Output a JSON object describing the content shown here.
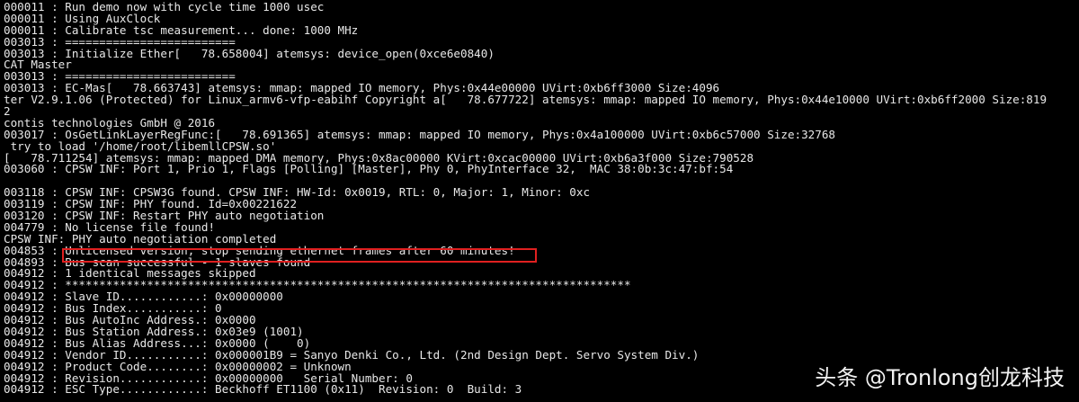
{
  "terminal": {
    "lines": [
      "000011 : Run demo now with cycle time 1000 usec",
      "000011 : Using AuxClock",
      "000011 : Calibrate tsc measurement... done: 1000 MHz",
      "003013 : =========================",
      "003013 : Initialize Ether[   78.658004] atemsys: device_open(0xce6e0840)",
      "CAT Master",
      "003013 : =========================",
      "003013 : EC-Mas[   78.663743] atemsys: mmap: mapped IO memory, Phys:0x44e00000 UVirt:0xb6ff3000 Size:4096",
      "ter V2.9.1.06 (Protected) for Linux_armv6-vfp-eabihf Copyright a[   78.677722] atemsys: mmap: mapped IO memory, Phys:0x44e10000 UVirt:0xb6ff2000 Size:819",
      "2",
      "contis technologies GmbH @ 2016",
      "003017 : OsGetLinkLayerRegFunc:[   78.691365] atemsys: mmap: mapped IO memory, Phys:0x4a100000 UVirt:0xb6c57000 Size:32768",
      " try to load '/home/root/libemllCPSW.so'",
      "[   78.711254] atemsys: mmap: mapped DMA memory, Phys:0x8ac00000 KVirt:0xcac00000 UVirt:0xb6a3f000 Size:790528",
      "003060 : CPSW INF: Port 1, Prio 1, Flags [Polling] [Master], Phy 0, PhyInterface 32,  MAC 38:0b:3c:47:bf:54",
      "",
      "003118 : CPSW INF: CPSW3G found. CPSW INF: HW-Id: 0x0019, RTL: 0, Major: 1, Minor: 0xc",
      "003119 : CPSW INF: PHY found. Id=0x00221622",
      "003120 : CPSW INF: Restart PHY auto negotiation",
      "004779 : No license file found!",
      "CPSW INF: PHY auto negotiation completed",
      "004853 : Unlicensed version, stop sending ethernet frames after 60 minutes!",
      "004893 : Bus scan successful - 1 slaves found",
      "004912 : 1 identical messages skipped",
      "004912 : ***********************************************************************************",
      "004912 : Slave ID............: 0x00000000",
      "004912 : Bus Index...........: 0",
      "004912 : Bus AutoInc Address.: 0x0000",
      "004912 : Bus Station Address.: 0x03e9 (1001)",
      "004912 : Bus Alias Address...: 0x0000 (    0)",
      "004912 : Vendor ID...........: 0x000001B9 = Sanyo Denki Co., Ltd. (2nd Design Dept. Servo System Div.)",
      "004912 : Product Code........: 0x00000002 = Unknown",
      "004912 : Revision............: 0x00000000   Serial Number: 0",
      "004912 : ESC Type............: Beckhoff ET1100 (0x11)  Revision: 0  Build: 3"
    ]
  },
  "watermark": {
    "text": "头条 @Tronlong创龙科技"
  },
  "highlight": {
    "color": "#e02020"
  }
}
